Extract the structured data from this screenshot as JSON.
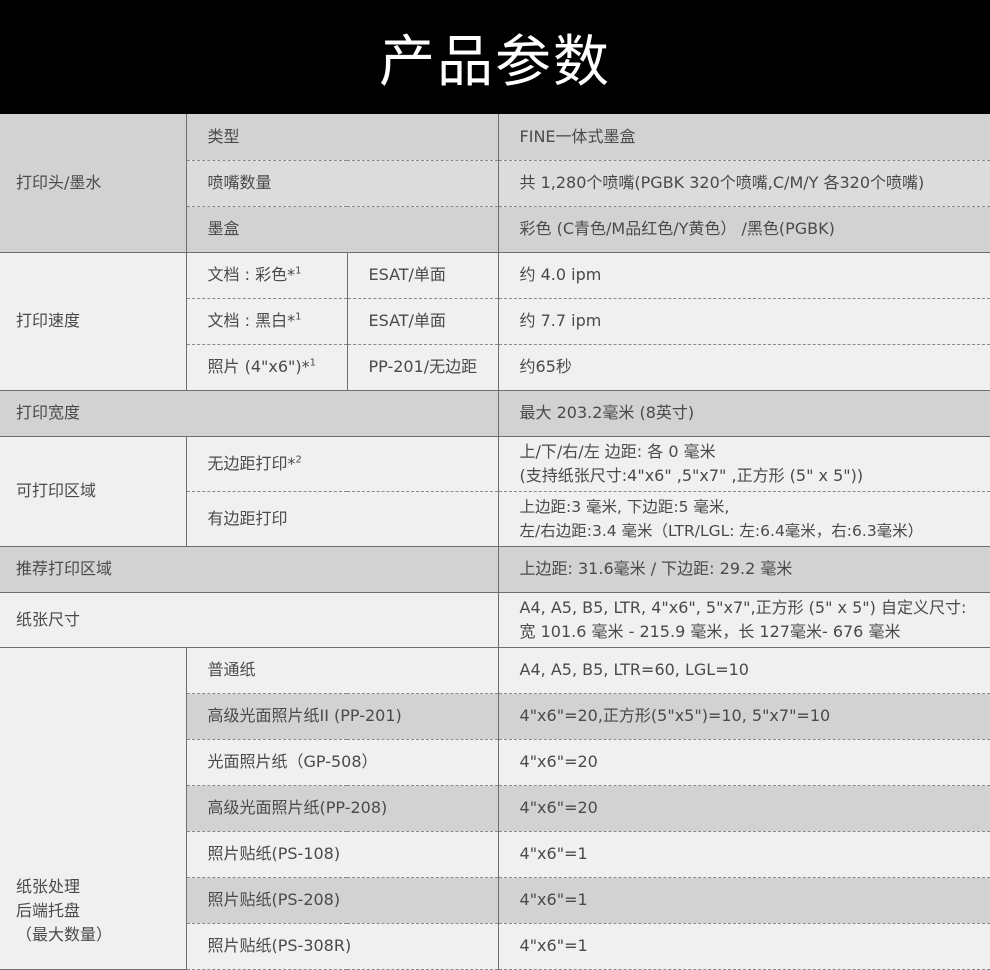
{
  "title": "产品参数",
  "printhead": {
    "label": "打印头/墨水",
    "rows": [
      {
        "name": "类型",
        "value": "FINE一体式墨盒"
      },
      {
        "name": "喷嘴数量",
        "value": "共 1,280个喷嘴(PGBK 320个喷嘴,C/M/Y 各320个喷嘴)"
      },
      {
        "name": "墨盒",
        "value": "彩色 (C青色/M品红色/Y黄色） /黑色(PGBK)"
      }
    ]
  },
  "speed": {
    "label": "打印速度",
    "rows": [
      {
        "name": "文档 : 彩色*",
        "sup": "1",
        "mode": "ESAT/单面",
        "value": "约 4.0 ipm"
      },
      {
        "name": "文档 : 黑白*",
        "sup": "1",
        "mode": "ESAT/单面",
        "value": "约 7.7 ipm"
      },
      {
        "name": "照片 (4\"x6\")*",
        "sup": "1",
        "mode": "PP-201/无边距",
        "value": "约65秒"
      }
    ]
  },
  "width": {
    "label": "打印宽度",
    "value": "最大 203.2毫米 (8英寸)"
  },
  "area": {
    "label": "可打印区域",
    "rows": [
      {
        "name": "无边距打印*",
        "sup": "2",
        "line1": "上/下/右/左 边距: 各 0 毫米",
        "line2": "(支持纸张尺寸:4\"x6\" ,5\"x7\" ,正方形 (5\" x 5\"))"
      },
      {
        "name": "有边距打印",
        "sup": "",
        "line1": "上边距:3 毫米, 下边距:5 毫米,",
        "line2": "左/右边距:3.4 毫米（LTR/LGL: 左:6.4毫米，右:6.3毫米）"
      }
    ]
  },
  "recommended": {
    "label": "推荐打印区域",
    "value": "上边距: 31.6毫米 / 下边距: 29.2 毫米"
  },
  "paper_size": {
    "label": "纸张尺寸",
    "line1": "A4, A5, B5, LTR,  4\"x6\", 5\"x7\",正方形 (5\" x 5\") 自定义尺寸:",
    "line2": "宽 101.6 毫米 - 215.9 毫米，长 127毫米- 676 毫米"
  },
  "paper_handling": {
    "label_line1": "纸张处理",
    "label_line2": "后端托盘",
    "label_line3": "（最大数量）",
    "rows": [
      {
        "name": "普通纸",
        "value": "A4, A5, B5, LTR=60, LGL=10"
      },
      {
        "name": "高级光面照片纸II (PP-201)",
        "value": "4\"x6\"=20,正方形(5\"x5\")=10, 5\"x7\"=10"
      },
      {
        "name": "光面照片纸（GP-508）",
        "value": "4\"x6\"=20"
      },
      {
        "name": "高级光面照片纸(PP-208)",
        "value": "4\"x6\"=20"
      },
      {
        "name": "照片贴纸(PS-108)",
        "value": "4\"x6\"=1"
      },
      {
        "name": "照片贴纸(PS-208)",
        "value": "4\"x6\"=1"
      },
      {
        "name": "照片贴纸(PS-308R)",
        "value": "4\"x6\"=1"
      }
    ]
  }
}
